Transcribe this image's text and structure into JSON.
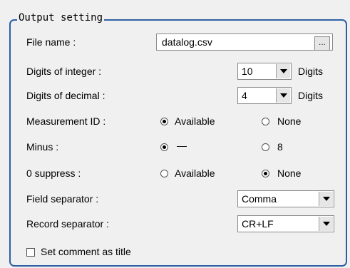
{
  "group_title": "Output setting",
  "file_name": {
    "label": "File name :",
    "value": "datalog.csv",
    "browse_label": "..."
  },
  "digits_integer": {
    "label": "Digits of integer :",
    "value": "10",
    "unit": "Digits"
  },
  "digits_decimal": {
    "label": "Digits of decimal :",
    "value": "4",
    "unit": "Digits"
  },
  "measurement_id": {
    "label": "Measurement ID :",
    "options": [
      "Available",
      "None"
    ],
    "selected": "Available"
  },
  "minus": {
    "label": "Minus :",
    "options": [
      "—",
      "8"
    ],
    "selected": "—"
  },
  "zero_suppress": {
    "label": "0 suppress :",
    "options": [
      "Available",
      "None"
    ],
    "selected": "None"
  },
  "field_separator": {
    "label": "Field separator :",
    "value": "Comma"
  },
  "record_separator": {
    "label": "Record separator :",
    "value": "CR+LF"
  },
  "comment_title": {
    "label": "Set comment as title",
    "checked": false
  }
}
